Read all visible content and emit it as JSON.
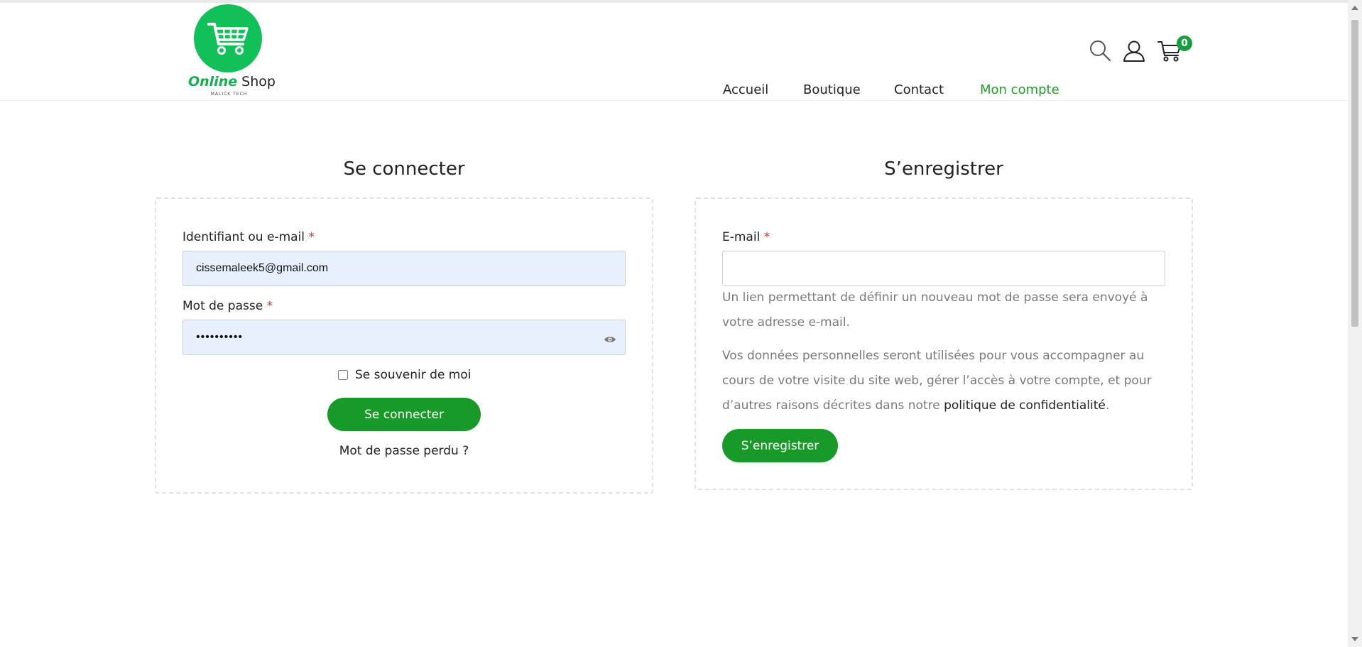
{
  "header": {
    "logo": {
      "brand_a": "Online",
      "brand_b": " Shop",
      "tagline": "MALICK TECH"
    },
    "nav": [
      {
        "label": "Accueil"
      },
      {
        "label": "Boutique"
      },
      {
        "label": "Contact"
      },
      {
        "label": "Mon compte",
        "active": true
      }
    ],
    "cart_count": "0",
    "icons": [
      "search-icon",
      "user-icon",
      "cart-icon"
    ],
    "accent_color": "#1fa025"
  },
  "login": {
    "title": "Se connecter",
    "username_label": "Identifiant ou e-mail",
    "required_mark": "*",
    "username_value": "cissemaleek5@gmail.com",
    "password_label": "Mot de passe",
    "password_value": "••••••••••",
    "remember_label": "Se souvenir de moi",
    "remember_checked": false,
    "submit_label": "Se connecter",
    "lost_password": "Mot de passe perdu ?"
  },
  "register": {
    "title": "S’enregistrer",
    "email_label": "E-mail",
    "required_mark": "*",
    "email_value": "",
    "notice": "Un lien permettant de définir un nouveau mot de passe sera envoyé à votre adresse e-mail.",
    "privacy_text": "Vos données personnelles seront utilisées pour vous accompagner au cours de votre visite du site web, gérer l’accès à votre compte, et pour d’autres raisons décrites dans notre ",
    "privacy_link": "politique de confidentialité",
    "privacy_end": ".",
    "submit_label": "S’enregistrer"
  }
}
